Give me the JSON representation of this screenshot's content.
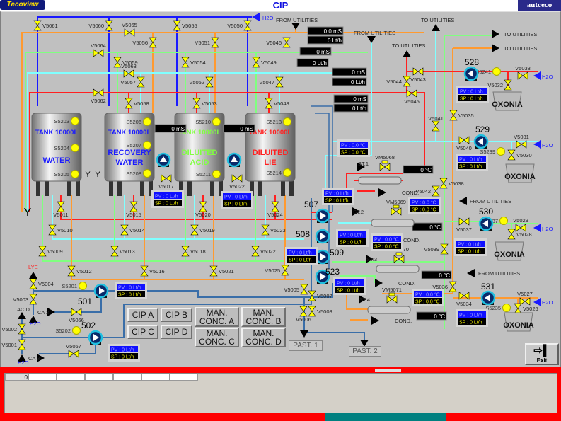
{
  "header": {
    "title": "CIP",
    "logo_left": "Tecoview",
    "logo_right": "autceco"
  },
  "colors": {
    "water": "#1a1aff",
    "orange": "#ff9a30",
    "green": "#80ff80",
    "cyan": "#80ffff",
    "red": "#ff2020",
    "process": "#3a6ea8",
    "valve": "#ffff00",
    "alarm_frame": "#ff0000"
  },
  "valves": [
    "V5061",
    "V5060",
    "V5065",
    "V5055",
    "V5050",
    "V5056",
    "V5051",
    "V5046",
    "V5064",
    "V5059",
    "V5063",
    "V5054",
    "V5049",
    "V5057",
    "V5052",
    "V5047",
    "V5062",
    "V5058",
    "V5053",
    "V5048",
    "V5017",
    "V5022",
    "V5011",
    "V5015",
    "V5020",
    "V5024",
    "V5010",
    "V5014",
    "V5019",
    "V5023",
    "V5009",
    "V5013",
    "V5018",
    "V5022",
    "V5012",
    "V5016",
    "V5021",
    "V5025",
    "V5004",
    "V5003",
    "V5066",
    "V5002",
    "V5001",
    "V5067",
    "V5005",
    "V5007",
    "V5006",
    "V5008",
    "V5043",
    "V5044",
    "V5045",
    "V5041",
    "V5035",
    "V5040",
    "V5031",
    "V5030",
    "V5038",
    "V5042",
    "V5037",
    "V5029",
    "V5028",
    "V5039",
    "V5036",
    "V5034",
    "V5027",
    "V5026",
    "V5033",
    "V5032",
    "VM5068",
    "VM5069",
    "VM5070",
    "VM5071"
  ],
  "sensors": [
    "S5203",
    "S5204",
    "S5205",
    "S5206",
    "S5207",
    "S5208",
    "S5210",
    "S5211",
    "S5213",
    "S5214",
    "S5201",
    "S5202",
    "S5241",
    "S5239",
    "S5237",
    "S5235"
  ],
  "tanks": [
    {
      "line1": "TANK 10000L",
      "line2": "WATER",
      "line3": "",
      "color": "#1a1aff"
    },
    {
      "line1": "TANK 10000L",
      "line2": "RECOVERY",
      "line3": "WATER",
      "color": "#1a1aff"
    },
    {
      "line1": "TANK 10000L",
      "line2": "DILUITED",
      "line3": "ACID",
      "color": "#80ff40"
    },
    {
      "line1": "TANK 10000L",
      "line2": "DILUITED",
      "line3": "LIE",
      "color": "#ff2020"
    }
  ],
  "pumps": [
    "501",
    "502",
    "507",
    "508",
    "509",
    "523",
    "528",
    "529",
    "530",
    "531",
    "",
    ""
  ],
  "pvsp": [
    {
      "pv": "PV : 0 Lt/h",
      "sp": "SP : 0 Lt/h"
    },
    {
      "pv": "PV : 0 Lt/h",
      "sp": "SP : 0 Lt/h"
    },
    {
      "pv": "PV : 0 Lt/h",
      "sp": "SP : 0 Lt/h"
    },
    {
      "pv": "PV : 0 Lt/h",
      "sp": "SP : 0 Lt/h"
    },
    {
      "pv": "PV : 0 Lt/h",
      "sp": "SP : 0 Lt/h"
    },
    {
      "pv": "PV : 0 Lt/h",
      "sp": "SP : 0 Lt/h"
    },
    {
      "pv": "PV : 0 Lt/h",
      "sp": "SP : 0 Lt/h"
    },
    {
      "pv": "PV : 0 Lt/h",
      "sp": "SP : 0 Lt/h"
    },
    {
      "pv": "PV : 0.0 °C",
      "sp": "SP : 0.0 °C"
    },
    {
      "pv": "PV : 0.0 °C",
      "sp": "SP : 0.0 °C"
    },
    {
      "pv": "PV : 0.0 °C",
      "sp": "SP : 0.0 °C"
    },
    {
      "pv": "PV : 0.0 °C",
      "sp": "SP : 0.0 °C"
    },
    {
      "pv": "PV : 0 Lt/h",
      "sp": "SP : 0 Lt/h"
    },
    {
      "pv": "PV : 0 Lt/h",
      "sp": "SP : 0 Lt/h"
    },
    {
      "pv": "PV : 0 Lt/h",
      "sp": "SP : 0 Lt/h"
    },
    {
      "pv": "PV : 0 Lt/h",
      "sp": "SP : 0 Lt/h"
    }
  ],
  "displays": [
    "0,0 mS",
    "0 Lt/h",
    "0 mS",
    "0 Lt/h",
    "0 mS",
    "0 Lt/h",
    "0 mS",
    "0 Lt/h",
    "0 mS",
    "0 mS",
    "0 °C",
    "0 °C",
    "0 °C",
    "0 °C"
  ],
  "labels": [
    "FROM UTILITIES",
    "FROM UTILITIES",
    "TO UTILITIES",
    "TO UTILITIES",
    "TO UTILITIES",
    "TO UTILITIES",
    "FROM UTILITIES",
    "FROM UTILITIES",
    "H2O",
    "H2O",
    "H2O",
    "H2O",
    "H2O",
    "H2O",
    "H2O",
    "LYE",
    "ACID",
    "CA 2",
    "CA 3",
    "ST.1",
    "ST.2",
    "ST.3",
    "ST.4",
    "COND.",
    "COND.",
    "COND.",
    "COND.",
    "OXONIA",
    "OXONIA",
    "OXONIA",
    "OXONIA"
  ],
  "buttons": {
    "cip_a": "CIP A",
    "cip_b": "CIP B",
    "cip_c": "CIP C",
    "cip_d": "CIP D",
    "man_a": "MAN. CONC. A",
    "man_b": "MAN. CONC. B",
    "man_c": "MAN. CONC. C",
    "man_d": "MAN. CONC. D",
    "past1": "PAST. 1",
    "past2": "PAST. 2",
    "exit": "Exit"
  },
  "alarm_list": {
    "first_col": "0"
  }
}
